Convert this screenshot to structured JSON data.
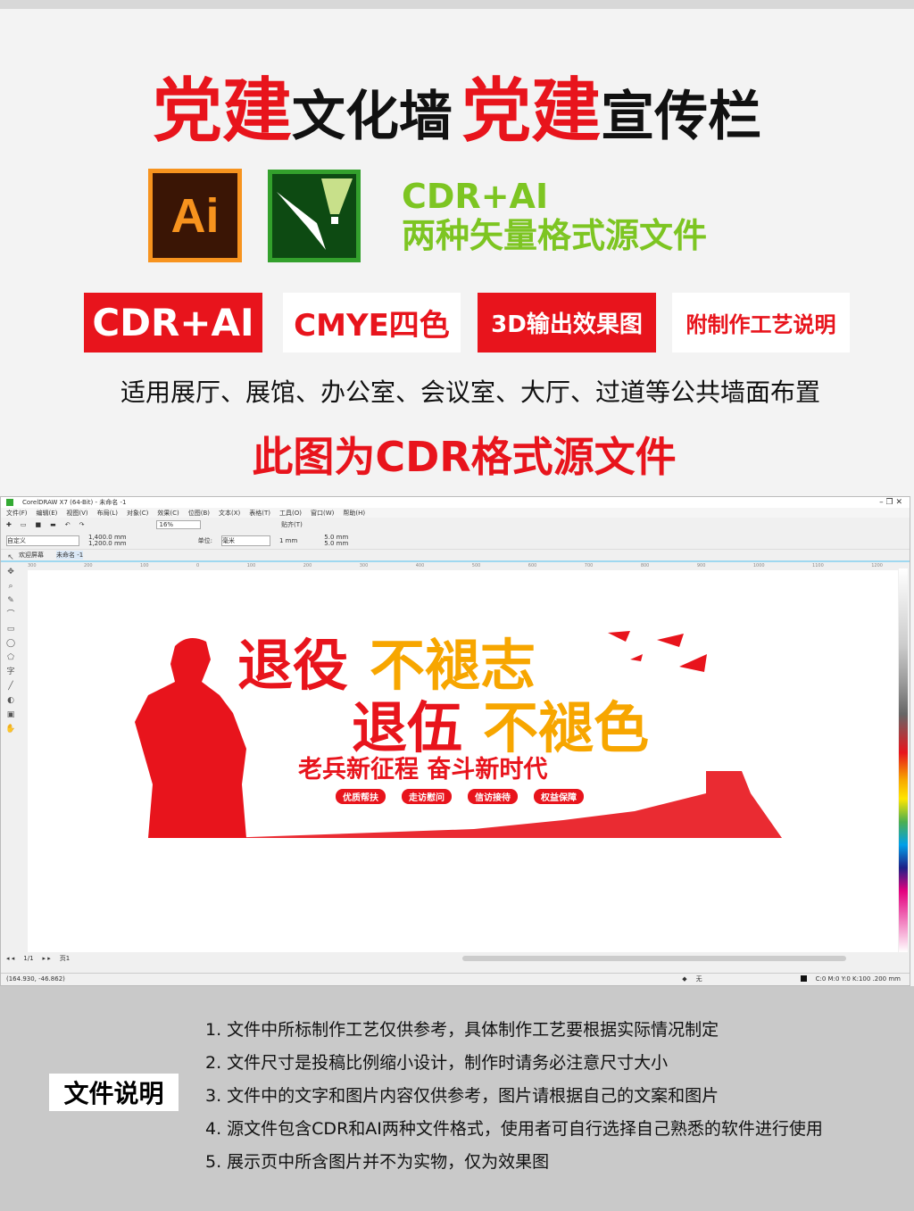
{
  "title": {
    "part1_red": "党建",
    "part1_black": "文化墙",
    "part2_red": "党建",
    "part2_black": "宣传栏"
  },
  "logos": {
    "ai": "Ai",
    "cdr": "coreldraw-icon"
  },
  "formats": {
    "line1": "CDR+AI",
    "line2": "两种矢量格式源文件"
  },
  "badges": [
    "CDR+AI",
    "CMYE四色",
    "3D输出效果图",
    "附制作工艺说明"
  ],
  "description": "适用展厅、展馆、办公室、会议室、大厅、过道等公共墙面布置",
  "source_note": "此图为CDR格式源文件",
  "colors": {
    "red": "#e8141c",
    "orange": "#f7a600",
    "green": "#7dc522"
  },
  "corel": {
    "title": "CorelDRAW X7 (64-Bit) - 未命名 -1",
    "menu": [
      "文件(F)",
      "编辑(E)",
      "视图(V)",
      "布局(L)",
      "对象(C)",
      "效果(C)",
      "位图(B)",
      "文本(X)",
      "表格(T)",
      "工具(O)",
      "窗口(W)",
      "帮助(H)"
    ],
    "zoom": "16%",
    "snap": "贴齐(T)",
    "page_preset": "自定义",
    "width": "1,400.0 mm",
    "height": "1,200.0 mm",
    "unit_label": "单位:",
    "unit": "毫米",
    "nudge": "1 mm",
    "dup_x": "5.0 mm",
    "dup_y": "5.0 mm",
    "tabs": [
      "欢迎屏幕",
      "未命名 -1"
    ],
    "ruler": [
      "300",
      "200",
      "100",
      "0",
      "100",
      "200",
      "300",
      "400",
      "500",
      "600",
      "700",
      "800",
      "900",
      "1000",
      "1100",
      "1200"
    ],
    "page_nav": "1/1",
    "page_tab": "页1",
    "coords": "(164.930, -46.862)",
    "fill": "无",
    "outline": "C:0 M:0 Y:0 K:100  .200 mm"
  },
  "artwork": {
    "line1a": "退役",
    "line1b": "不褪志",
    "line2a": "退伍",
    "line2b": "不褪色",
    "slogan": "老兵新征程 奋斗新时代",
    "tags": [
      "优质帮扶",
      "走访慰问",
      "信访接待",
      "权益保障"
    ]
  },
  "notes": {
    "label": "文件说明",
    "items": [
      "1. 文件中所标制作工艺仅供参考，具体制作工艺要根据实际情况制定",
      "2. 文件尺寸是投稿比例缩小设计，制作时请务必注意尺寸大小",
      "3. 文件中的文字和图片内容仅供参考，图片请根据自己的文案和图片",
      "4. 源文件包含CDR和AI两种文件格式，使用者可自行选择自己熟悉的软件进行使用",
      "5. 展示页中所含图片并不为实物，仅为效果图"
    ]
  }
}
